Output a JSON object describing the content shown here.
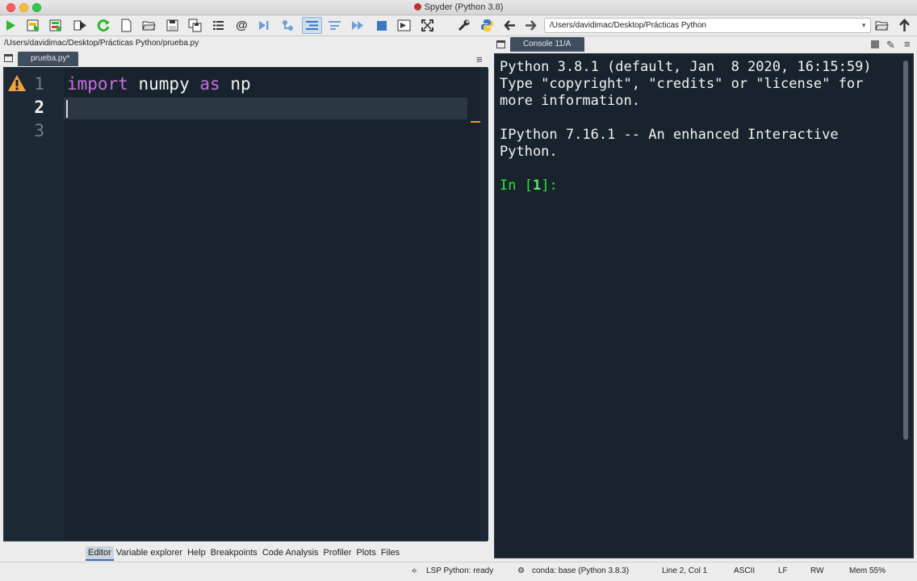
{
  "window": {
    "title": "Spyder (Python 3.8)"
  },
  "toolbar": {
    "working_dir": "/Users/davidimac/Desktop/Prácticas Python",
    "icons": [
      "run-icon",
      "run-cell-icon",
      "run-cell-advance-icon",
      "run-selection-icon",
      "rerun-icon",
      "new-file-icon",
      "open-file-icon",
      "save-icon",
      "save-all-icon",
      "list-icon",
      "at-icon",
      "debug-step-icon",
      "debug-cell-icon",
      "indent-icon",
      "dedent-icon",
      "continue-icon",
      "stop-icon",
      "maximize-pane-icon",
      "fullscreen-icon",
      "wrench-icon",
      "python-icon",
      "back-arrow-icon",
      "forward-arrow-icon",
      "folder-open-icon",
      "up-arrow-icon"
    ]
  },
  "editor": {
    "file_path": "/Users/davidimac/Desktop/Prácticas Python/prueba.py",
    "tab_label": "prueba.py*",
    "line_numbers": [
      "1",
      "2",
      "3"
    ],
    "code": {
      "kw1": "import",
      "name1": " numpy ",
      "kw2": "as",
      "name2": " np"
    }
  },
  "editor_tabs": [
    "Editor",
    "Variable explorer",
    "Help",
    "Breakpoints",
    "Code Analysis",
    "Profiler",
    "Plots",
    "Files"
  ],
  "console": {
    "tab_label": "Console 11/A",
    "banner1": "Python 3.8.1 (default, Jan  8 2020, 16:15:59)\nType \"copyright\", \"credits\" or \"license\" for\nmore information.",
    "banner2": "IPython 7.16.1 -- An enhanced Interactive\nPython.",
    "prompt_in": "In [",
    "prompt_num": "1",
    "prompt_end": "]:"
  },
  "statusbar": {
    "lsp": "LSP Python: ready",
    "conda": "conda: base (Python 3.8.3)",
    "position": "Line 2, Col 1",
    "encoding": "ASCII",
    "eol": "LF",
    "mode": "RW",
    "memory": "Mem 55%"
  },
  "colors": {
    "editor_bg": "#19232d",
    "keyword": "#c670e0",
    "prompt": "#2fe23a",
    "warning": "#f2a33a"
  }
}
